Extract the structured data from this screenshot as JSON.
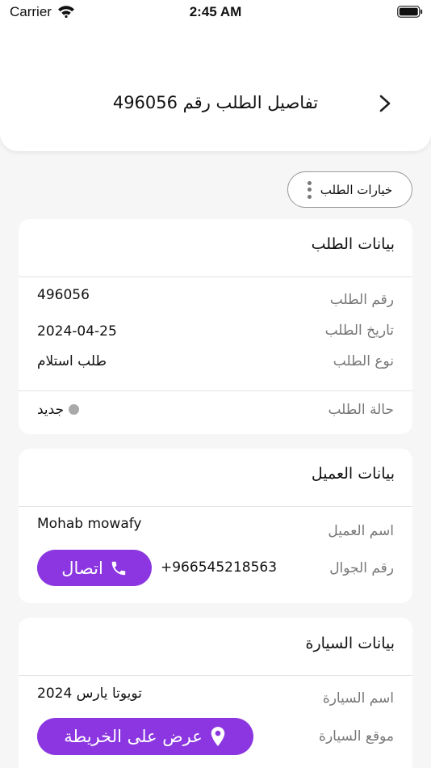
{
  "status_bar": {
    "carrier": "Carrier",
    "time": "2:45 AM"
  },
  "header": {
    "title": "تفاصيل الطلب رقم  496056"
  },
  "options_button": {
    "label": "خيارات الطلب"
  },
  "order_section": {
    "title": "بيانات الطلب",
    "number_label": "رقم الطلب",
    "number_value": "496056",
    "date_label": "تاريخ الطلب",
    "date_value": "2024-04-25",
    "type_label": "نوع الطلب",
    "type_value": "طلب استلام",
    "status_label": "حالة الطلب",
    "status_value": "جديد"
  },
  "customer_section": {
    "title": "بيانات العميل",
    "name_label": "اسم العميل",
    "name_value": "Mohab mowafy",
    "phone_label": "رقم الجوال",
    "phone_value": "+966545218563",
    "call_label": "اتصال"
  },
  "car_section": {
    "title": "بيانات السيارة",
    "name_label": "اسم السيارة",
    "name_value": "تويوتا يارس 2024",
    "location_label": "موقع السيارة",
    "map_label": "عرض على الخريطة"
  },
  "colors": {
    "accent": "#8b36e0",
    "status_dot": "#a9a9a9",
    "background": "#f6f6f6"
  },
  "icons": [
    "wifi-icon",
    "battery-icon",
    "chevron-right-icon",
    "kebab-icon",
    "phone-icon",
    "location-pin-icon"
  ]
}
